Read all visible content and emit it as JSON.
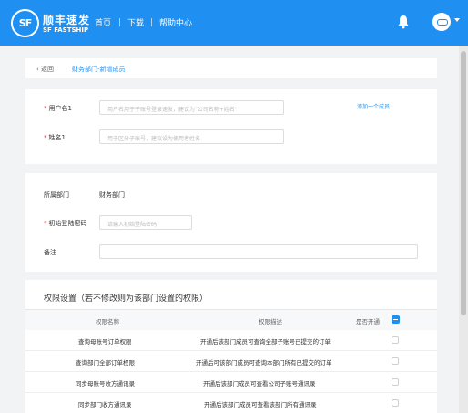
{
  "header": {
    "logo_mark": "SF",
    "logo_cn": "顺丰速发",
    "logo_en": "SF FASTSHIP",
    "nav": [
      "首页",
      "下载",
      "帮助中心"
    ],
    "bg_color": "#1f8ff1"
  },
  "breadcrumb": {
    "back_label": "返回",
    "current": "财务部门-新增成员"
  },
  "form1": {
    "username_label": "用户名1",
    "username_placeholder": "用户名用于子账号登录速发，建议为\"公司名称+姓名\"",
    "name_label": "姓名1",
    "name_placeholder": "用于区分子账号，建议设为使用者姓名",
    "add_member_link": "添加一个成员"
  },
  "form2": {
    "dept_label": "所属部门",
    "dept_value": "财务部门",
    "password_label": "初始登陆密码",
    "password_placeholder": "请输入初始登陆密码",
    "remark_label": "备注",
    "remark_value": ""
  },
  "permissions": {
    "title": "权限设置（若不修改则为该部门设置的权限）",
    "columns": [
      "权限名称",
      "权限描述",
      "是否开通"
    ],
    "rows": [
      {
        "name": "查询母账号订单权限",
        "desc": "开通后该部门成员可查询全部子账号已提交的订单"
      },
      {
        "name": "查询部门全部订单权限",
        "desc": "开通后可该部门成员可查询本部门所有已提交的订单"
      },
      {
        "name": "同步母账号收方通讯录",
        "desc": "开通后该部门成员可查看公司子账号通讯录"
      },
      {
        "name": "同步部门收方通讯录",
        "desc": "开通后该部门成员可查看该部门所有通讯录"
      }
    ]
  },
  "icons": {
    "bell": "bell-icon",
    "avatar": "avatar-icon",
    "back": "chevron-left-icon"
  }
}
